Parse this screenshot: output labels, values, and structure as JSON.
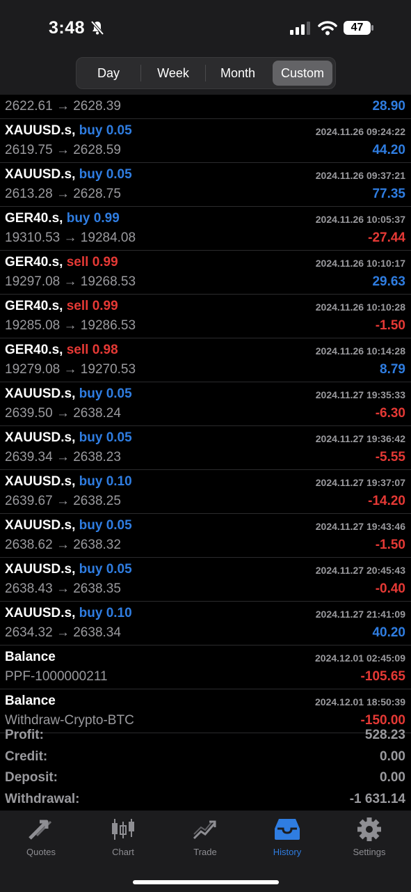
{
  "status_bar": {
    "time": "3:48",
    "battery": "47"
  },
  "period_tabs": [
    {
      "label": "Day",
      "active": false
    },
    {
      "label": "Week",
      "active": false
    },
    {
      "label": "Month",
      "active": false
    },
    {
      "label": "Custom",
      "active": true
    }
  ],
  "first_row": {
    "prices": "2622.61 → 2628.39",
    "profit": "28.90"
  },
  "trades": [
    {
      "symbol": "XAUUSD.s,",
      "side": "buy",
      "volume": "0.05",
      "side_label": "buy 0.05",
      "date": "2024.11.26 09:24:22",
      "prices": "2619.75 → 2628.59",
      "profit": "44.20",
      "positive": true
    },
    {
      "symbol": "XAUUSD.s,",
      "side": "buy",
      "side_label": "buy 0.05",
      "date": "2024.11.26 09:37:21",
      "prices": "2613.28 → 2628.75",
      "profit": "77.35",
      "positive": true
    },
    {
      "symbol": "GER40.s,",
      "side": "buy",
      "side_label": "buy 0.99",
      "date": "2024.11.26 10:05:37",
      "prices": "19310.53 → 19284.08",
      "profit": "-27.44",
      "positive": false
    },
    {
      "symbol": "GER40.s,",
      "side": "sell",
      "side_label": "sell 0.99",
      "date": "2024.11.26 10:10:17",
      "prices": "19297.08 → 19268.53",
      "profit": "29.63",
      "positive": true
    },
    {
      "symbol": "GER40.s,",
      "side": "sell",
      "side_label": "sell 0.99",
      "date": "2024.11.26 10:10:28",
      "prices": "19285.08 → 19286.53",
      "profit": "-1.50",
      "positive": false
    },
    {
      "symbol": "GER40.s,",
      "side": "sell",
      "side_label": "sell 0.98",
      "date": "2024.11.26 10:14:28",
      "prices": "19279.08 → 19270.53",
      "profit": "8.79",
      "positive": true
    },
    {
      "symbol": "XAUUSD.s,",
      "side": "buy",
      "side_label": "buy 0.05",
      "date": "2024.11.27 19:35:33",
      "prices": "2639.50 → 2638.24",
      "profit": "-6.30",
      "positive": false
    },
    {
      "symbol": "XAUUSD.s,",
      "side": "buy",
      "side_label": "buy 0.05",
      "date": "2024.11.27 19:36:42",
      "prices": "2639.34 → 2638.23",
      "profit": "-5.55",
      "positive": false
    },
    {
      "symbol": "XAUUSD.s,",
      "side": "buy",
      "side_label": "buy 0.10",
      "date": "2024.11.27 19:37:07",
      "prices": "2639.67 → 2638.25",
      "profit": "-14.20",
      "positive": false
    },
    {
      "symbol": "XAUUSD.s,",
      "side": "buy",
      "side_label": "buy 0.05",
      "date": "2024.11.27 19:43:46",
      "prices": "2638.62 → 2638.32",
      "profit": "-1.50",
      "positive": false
    },
    {
      "symbol": "XAUUSD.s,",
      "side": "buy",
      "side_label": "buy 0.05",
      "date": "2024.11.27 20:45:43",
      "prices": "2638.43 → 2638.35",
      "profit": "-0.40",
      "positive": false
    },
    {
      "symbol": "XAUUSD.s,",
      "side": "buy",
      "side_label": "buy 0.10",
      "date": "2024.11.27 21:41:09",
      "prices": "2634.32 → 2638.34",
      "profit": "40.20",
      "positive": true
    },
    {
      "symbol": "Balance",
      "side": "",
      "side_label": "",
      "date": "2024.12.01 02:45:09",
      "prices": "PPF-1000000211",
      "profit": "-105.65",
      "positive": false
    },
    {
      "symbol": "Balance",
      "side": "",
      "side_label": "",
      "date": "2024.12.01 18:50:39",
      "prices": "Withdraw-Crypto-BTC",
      "profit": "-150.00",
      "positive": false
    }
  ],
  "summary": [
    {
      "label": "Profit:",
      "value": "528.23"
    },
    {
      "label": "Credit:",
      "value": "0.00"
    },
    {
      "label": "Deposit:",
      "value": "0.00"
    },
    {
      "label": "Withdrawal:",
      "value": "-1 631.14"
    }
  ],
  "tab_bar": [
    {
      "label": "Quotes",
      "icon": "quotes-arrows-icon",
      "active": false
    },
    {
      "label": "Chart",
      "icon": "candlestick-icon",
      "active": false
    },
    {
      "label": "Trade",
      "icon": "trade-trend-icon",
      "active": false
    },
    {
      "label": "History",
      "icon": "inbox-tray-icon",
      "active": true
    },
    {
      "label": "Settings",
      "icon": "gear-icon",
      "active": false
    }
  ],
  "colors": {
    "buy": "#2f7de1",
    "sell": "#e53935",
    "active_tab": "#2f7de1"
  }
}
